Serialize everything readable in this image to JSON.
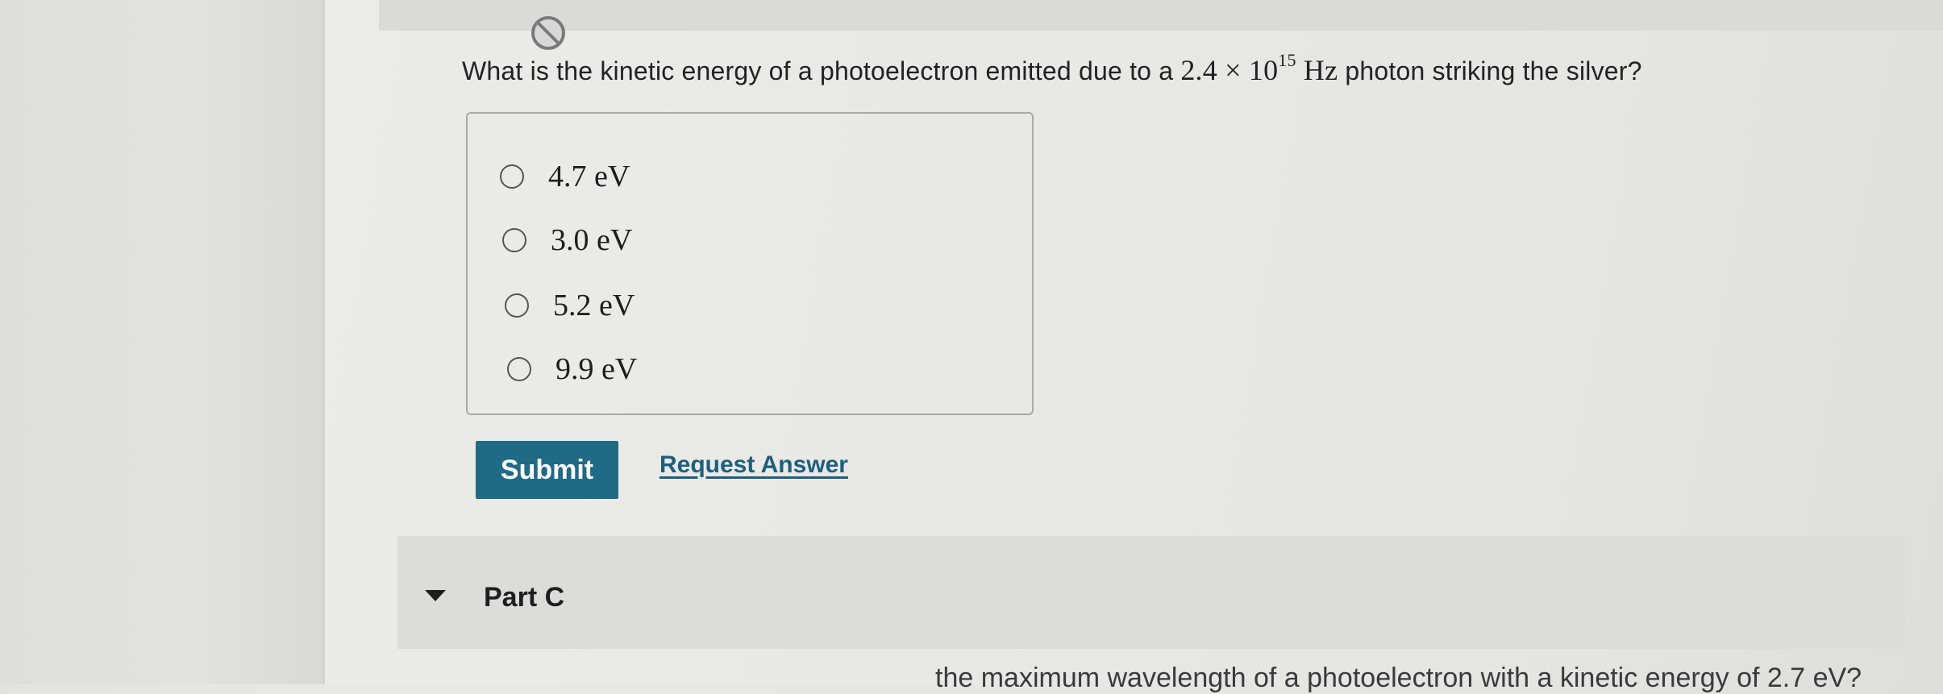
{
  "question": {
    "prefix": "What is the kinetic energy of a photoelectron emitted due to a ",
    "mantissa": "2.4",
    "times": "×",
    "base": "10",
    "exponent": "15",
    "unit": "Hz",
    "suffix": " photon striking the silver?"
  },
  "options": [
    {
      "label": "4.7 eV",
      "selected": false
    },
    {
      "label": "3.0 eV",
      "selected": false
    },
    {
      "label": "5.2 eV",
      "selected": false
    },
    {
      "label": "9.9 eV",
      "selected": false
    }
  ],
  "actions": {
    "submit_label": "Submit",
    "request_answer_label": "Request Answer"
  },
  "next_part": {
    "label": "Part C",
    "cut_text": "the maximum wavelength of a photoelectron with a kinetic energy of 2.7 eV?"
  },
  "colors": {
    "submit_bg": "#1f6b86",
    "link": "#1d5f7e"
  },
  "icons": {
    "top": "blocked-circle-icon",
    "part_toggle": "caret-down-icon"
  }
}
